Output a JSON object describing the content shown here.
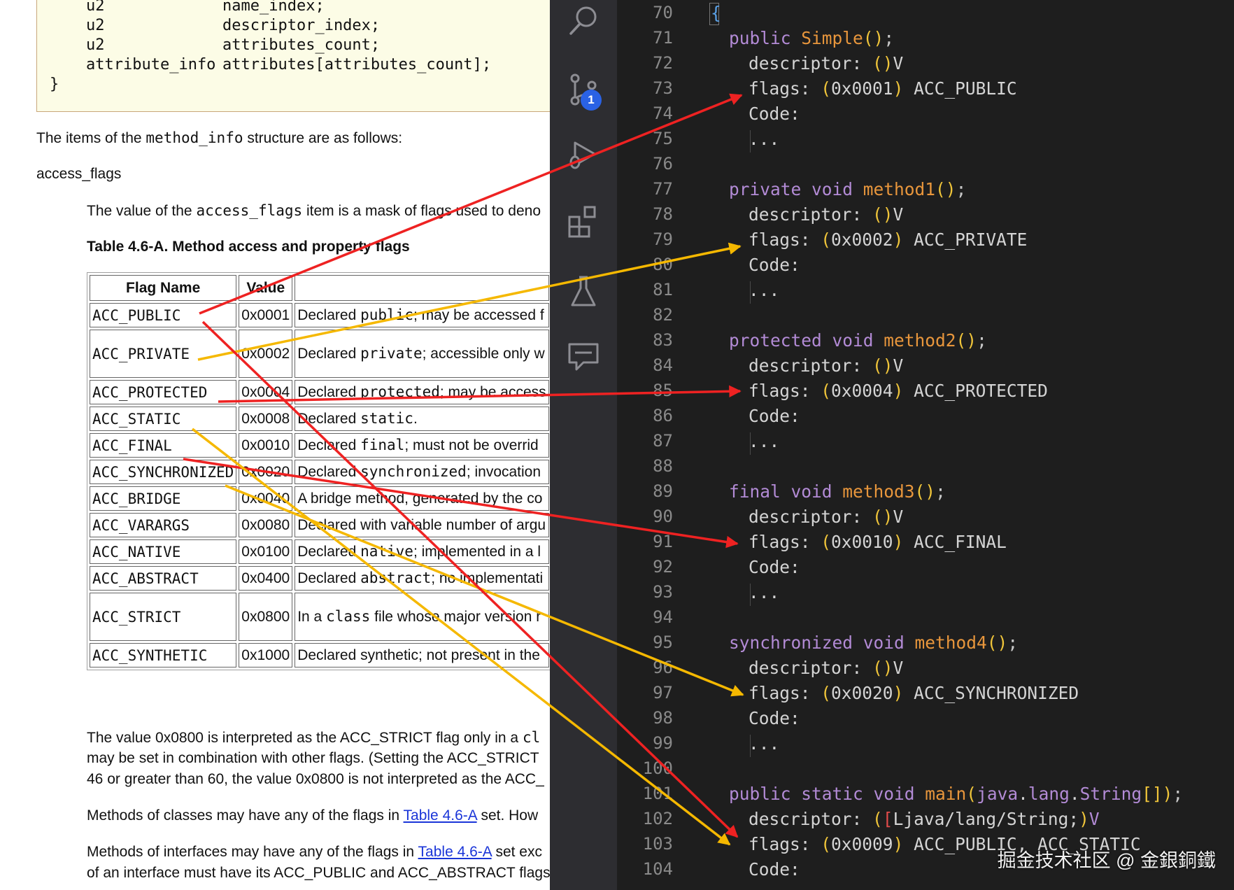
{
  "doc": {
    "code_lines": [
      {
        "type": "u2",
        "name": "name_index;"
      },
      {
        "type": "u2",
        "name": "descriptor_index;"
      },
      {
        "type": "u2",
        "name": "attributes_count;"
      },
      {
        "type": "attribute_info",
        "name": "attributes[attributes_count];"
      }
    ],
    "code_close": "}",
    "intro_prefix": "The items of the ",
    "intro_code": "method_info",
    "intro_suffix": " structure are as follows:",
    "section_heading": "access_flags",
    "desc_prefix": "The value of the ",
    "desc_code": "access_flags",
    "desc_suffix": " item is a mask of flags used to deno",
    "table_caption": "Table 4.6-A. Method access and property flags",
    "table_headers": [
      "Flag Name",
      "Value",
      ""
    ],
    "table_rows": [
      {
        "name": "ACC_PUBLIC",
        "value": "0x0001",
        "desc_pre": "Declared ",
        "desc_code": "public",
        "desc_post": "; may be accessed f"
      },
      {
        "name": "ACC_PRIVATE",
        "value": "0x0002",
        "desc_pre": "Declared ",
        "desc_code": "private",
        "desc_post": "; accessible only w"
      },
      {
        "name": "ACC_PROTECTED",
        "value": "0x0004",
        "desc_pre": "Declared ",
        "desc_code": "protected",
        "desc_post": "; may be access"
      },
      {
        "name": "ACC_STATIC",
        "value": "0x0008",
        "desc_pre": "Declared ",
        "desc_code": "static",
        "desc_post": "."
      },
      {
        "name": "ACC_FINAL",
        "value": "0x0010",
        "desc_pre": "Declared ",
        "desc_code": "final",
        "desc_post": "; must not be overrid"
      },
      {
        "name": "ACC_SYNCHRONIZED",
        "value": "0x0020",
        "desc_pre": "Declared ",
        "desc_code": "synchronized",
        "desc_post": "; invocation"
      },
      {
        "name": "ACC_BRIDGE",
        "value": "0x0040",
        "desc_pre": "A bridge method, generated by the co",
        "desc_code": "",
        "desc_post": ""
      },
      {
        "name": "ACC_VARARGS",
        "value": "0x0080",
        "desc_pre": "Declared with variable number of argu",
        "desc_code": "",
        "desc_post": ""
      },
      {
        "name": "ACC_NATIVE",
        "value": "0x0100",
        "desc_pre": "Declared ",
        "desc_code": "native",
        "desc_post": "; implemented in a l"
      },
      {
        "name": "ACC_ABSTRACT",
        "value": "0x0400",
        "desc_pre": "Declared ",
        "desc_code": "abstract",
        "desc_post": "; no implementati"
      },
      {
        "name": "ACC_STRICT",
        "value": "0x0800",
        "desc_pre": "In a ",
        "desc_code": "class",
        "desc_post": " file whose major version r"
      },
      {
        "name": "ACC_SYNTHETIC",
        "value": "0x1000",
        "desc_pre": "Declared synthetic; not present in the",
        "desc_code": "",
        "desc_post": ""
      }
    ],
    "note_lines": [
      {
        "pre": "The value 0x0800 is interpreted as the ACC_STRICT flag only in a ",
        "code": "cl"
      },
      {
        "pre": "may be set in combination with other flags. (Setting the ACC_STRICT",
        "code": ""
      },
      {
        "pre": "46 or greater than 60, the value 0x0800 is not interpreted as the ACC_",
        "code": ""
      }
    ],
    "classes_pre": "Methods of classes may have any of the flags in ",
    "classes_link": "Table 4.6-A",
    "classes_post": " set. How",
    "interfaces_pre": "Methods of interfaces may have any of the flags in ",
    "interfaces_link": "Table 4.6-A",
    "interfaces_post": " set exc",
    "interfaces_line2": "of an interface must have its ACC_PUBLIC and ACC_ABSTRACT flags"
  },
  "activity_bar": {
    "icons": [
      "search-icon",
      "source-control-icon",
      "run-debug-icon",
      "extensions-icon",
      "testing-icon",
      "comments-icon"
    ],
    "source_control_badge": "1",
    "badge_color": "#2a62e5"
  },
  "editor": {
    "line_numbers": [
      "70",
      "71",
      "72",
      "73",
      "74",
      "75",
      "76",
      "77",
      "78",
      "79",
      "80",
      "81",
      "82",
      "83",
      "84",
      "85",
      "86",
      "87",
      "88",
      "89",
      "90",
      "91",
      "92",
      "93",
      "94",
      "95",
      "96",
      "97",
      "98",
      "99",
      "100",
      "101",
      "102",
      "103",
      "104"
    ],
    "open_brace": "{",
    "blocks": [
      {
        "signature_kw": "public",
        "signature_fn": "Simple",
        "signature_tail": "();",
        "descriptor": "()V",
        "flags_value": "(0x0001)",
        "flags_name": "ACC_PUBLIC"
      },
      {
        "signature_kw": "private void",
        "signature_fn": "method1",
        "signature_tail": "();",
        "descriptor": "()V",
        "flags_value": "(0x0002)",
        "flags_name": "ACC_PRIVATE"
      },
      {
        "signature_kw": "protected void",
        "signature_fn": "method2",
        "signature_tail": "();",
        "descriptor": "()V",
        "flags_value": "(0x0004)",
        "flags_name": "ACC_PROTECTED"
      },
      {
        "signature_kw": "final void",
        "signature_fn": "method3",
        "signature_tail": "();",
        "descriptor": "()V",
        "flags_value": "(0x0010)",
        "flags_name": "ACC_FINAL"
      },
      {
        "signature_kw": "synchronized void",
        "signature_fn": "method4",
        "signature_tail": "();",
        "descriptor": "()V",
        "flags_value": "(0x0020)",
        "flags_name": "ACC_SYNCHRONIZED"
      }
    ],
    "main_signature_kw": "public static void",
    "main_signature_fn": "main",
    "main_signature_args": "java.lang.String[]",
    "main_signature_tail": ");",
    "main_descriptor": "([Ljava/lang/String;)V",
    "main_flags_value": "(0x0009)",
    "main_flags_name": "ACC_PUBLIC, ACC_STATIC",
    "label_descriptor": "descriptor:",
    "label_flags": "flags:",
    "label_code": "Code:",
    "ellipsis": "..."
  },
  "watermark": "掘金技术社区 @ 金銀銅鐵",
  "colors": {
    "arrow_red": "#ee2222",
    "arrow_yellow": "#f5b800",
    "editor_bg": "#1e1e1e",
    "keyword": "#b38bd6",
    "function": "#e8963c",
    "paren": "#f0c53a"
  },
  "arrow_links": [
    {
      "from": "ACC_PUBLIC",
      "to": "ACC_PUBLIC",
      "color": "red"
    },
    {
      "from": "ACC_PRIVATE",
      "to": "ACC_PRIVATE",
      "color": "yellow"
    },
    {
      "from": "ACC_PROTECTED",
      "to": "ACC_PROTECTED",
      "color": "red"
    },
    {
      "from": "ACC_FINAL",
      "to": "ACC_FINAL",
      "color": "red"
    },
    {
      "from": "ACC_SYNCHRONIZED",
      "to": "ACC_SYNCHRONIZED",
      "color": "yellow"
    },
    {
      "from": "ACC_PUBLIC",
      "to": "ACC_PUBLIC, ACC_STATIC",
      "color": "red"
    },
    {
      "from": "ACC_STATIC",
      "to": "ACC_PUBLIC, ACC_STATIC",
      "color": "yellow"
    }
  ]
}
